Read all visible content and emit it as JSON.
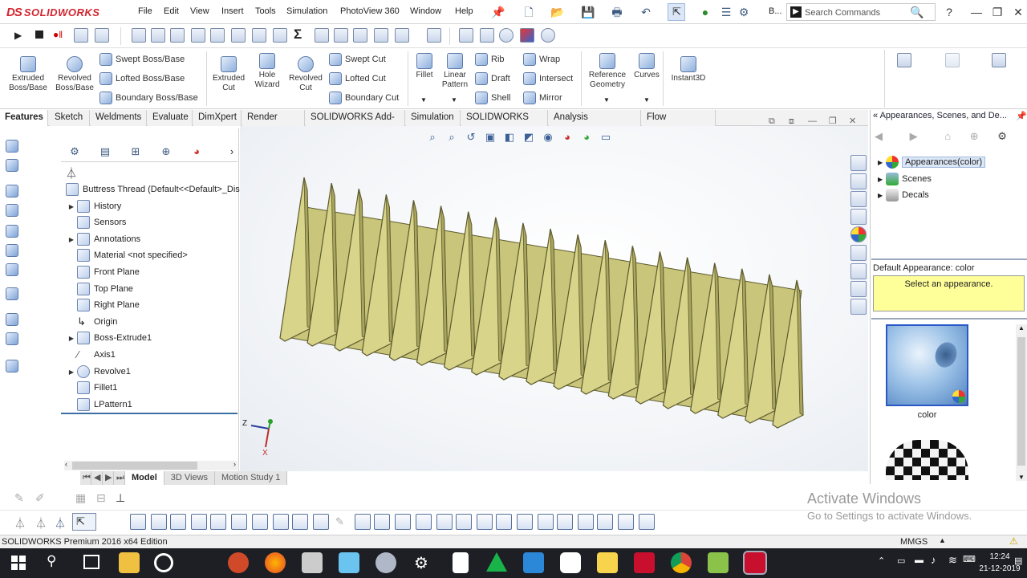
{
  "app": {
    "brand_prefix": "DS",
    "brand": "SOLIDWORKS",
    "menu": [
      "File",
      "Edit",
      "View",
      "Insert",
      "Tools",
      "Simulation",
      "PhotoView 360",
      "Window",
      "Help"
    ],
    "overflow_label": "B...",
    "search_placeholder": "Search Commands"
  },
  "command_manager": {
    "big_buttons": [
      {
        "label": "Extruded\nBoss/Base"
      },
      {
        "label": "Revolved\nBoss/Base"
      },
      {
        "label": "Extruded\nCut"
      },
      {
        "label": "Hole\nWizard"
      },
      {
        "label": "Revolved\nCut"
      },
      {
        "label": "Fillet"
      },
      {
        "label": "Linear\nPattern"
      },
      {
        "label": "Reference\nGeometry"
      },
      {
        "label": "Curves"
      },
      {
        "label": "Instant3D"
      }
    ],
    "small_buttons": [
      "Swept Boss/Base",
      "Lofted Boss/Base",
      "Boundary Boss/Base",
      "Swept Cut",
      "Lofted Cut",
      "Boundary Cut",
      "Rib",
      "Draft",
      "Shell",
      "Wrap",
      "Intersect",
      "Mirror"
    ]
  },
  "tabs": [
    "Features",
    "Sketch",
    "Weldments",
    "Evaluate",
    "DimXpert",
    "Render Tools",
    "SOLIDWORKS Add-Ins",
    "Simulation",
    "SOLIDWORKS MBD",
    "Analysis Preparation",
    "Flow Simulation"
  ],
  "active_tab": "Features",
  "feature_tree": {
    "root": "Buttress Thread  (Default<<Default>_Dis",
    "items": [
      {
        "label": "History",
        "expandable": true
      },
      {
        "label": "Sensors",
        "expandable": false
      },
      {
        "label": "Annotations",
        "expandable": true
      },
      {
        "label": "Material <not specified>",
        "expandable": false
      },
      {
        "label": "Front Plane",
        "expandable": false
      },
      {
        "label": "Top Plane",
        "expandable": false
      },
      {
        "label": "Right Plane",
        "expandable": false
      },
      {
        "label": "Origin",
        "expandable": false
      },
      {
        "label": "Boss-Extrude1",
        "expandable": true
      },
      {
        "label": "Axis1",
        "expandable": false
      },
      {
        "label": "Revolve1",
        "expandable": true
      },
      {
        "label": "Fillet1",
        "expandable": false
      },
      {
        "label": "LPattern1",
        "expandable": false
      }
    ]
  },
  "bottom_tabs": [
    "Model",
    "3D Views",
    "Motion Study 1"
  ],
  "active_bottom_tab": "Model",
  "triad": {
    "axis_z": "Z",
    "axis_x": "X"
  },
  "task_pane": {
    "title": "Appearances, Scenes, and De...",
    "tree": [
      "Appearances(color)",
      "Scenes",
      "Decals"
    ],
    "selected": "Appearances(color)",
    "default_appearance": "Default Appearance: color",
    "hint": "Select an appearance.",
    "thumbnail_label": "color"
  },
  "watermark": {
    "title": "Activate Windows",
    "subtitle": "Go to Settings to activate Windows."
  },
  "status_bar": {
    "edition": "SOLIDWORKS Premium 2016 x64 Edition",
    "units": "MMGS"
  },
  "taskbar": {
    "time": "12:24",
    "date": "21-12-2019"
  },
  "colors": {
    "brand_red": "#d22630",
    "thread_fill": "#d8d48a",
    "thread_edge": "#5c5a2e",
    "selection_blue": "#2a59c7"
  }
}
